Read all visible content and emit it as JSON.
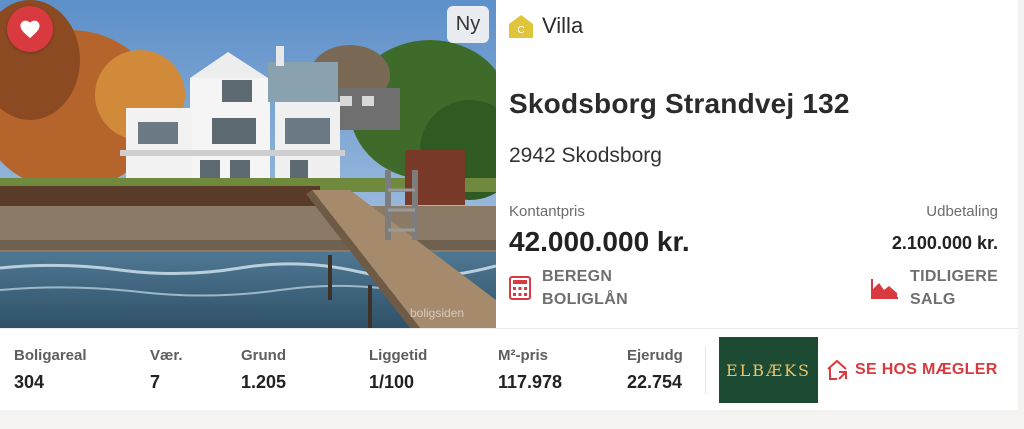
{
  "listing": {
    "badge_new": "Ny",
    "watermark": "boligsiden",
    "energy_label": "C",
    "type_label": "Villa",
    "address": "Skodsborg Strandvej 132",
    "city": "2942 Skodsborg",
    "price_label": "Kontantpris",
    "price": "42.000.000 kr.",
    "down_payment_label": "Udbetaling",
    "down_payment": "2.100.000 kr."
  },
  "actions": {
    "loan_line1": "BEREGN",
    "loan_line2": "BOLIGLÅN",
    "sales_line1": "TIDLIGERE",
    "sales_line2": "SALG",
    "agent_button": "SE HOS MÆGLER"
  },
  "stats": [
    {
      "label": "Boligareal",
      "value": "304"
    },
    {
      "label": "Vær.",
      "value": "7"
    },
    {
      "label": "Grund",
      "value": "1.205"
    },
    {
      "label": "Liggetid",
      "value": "1/100"
    },
    {
      "label": "M²-pris",
      "value": "117.978"
    },
    {
      "label": "Ejerudg",
      "value": "22.754"
    }
  ],
  "agent": {
    "logo_text": "ELBÆKS"
  },
  "icons": {
    "favorite": "heart-icon",
    "energy": "house-energy-icon",
    "loan": "calculator-icon",
    "sales": "area-chart-icon",
    "agent": "house-link-icon"
  },
  "colors": {
    "accent_red": "#d83a3f",
    "energy_yellow": "#e0c53a",
    "agent_logo_bg": "#1d4a33"
  }
}
